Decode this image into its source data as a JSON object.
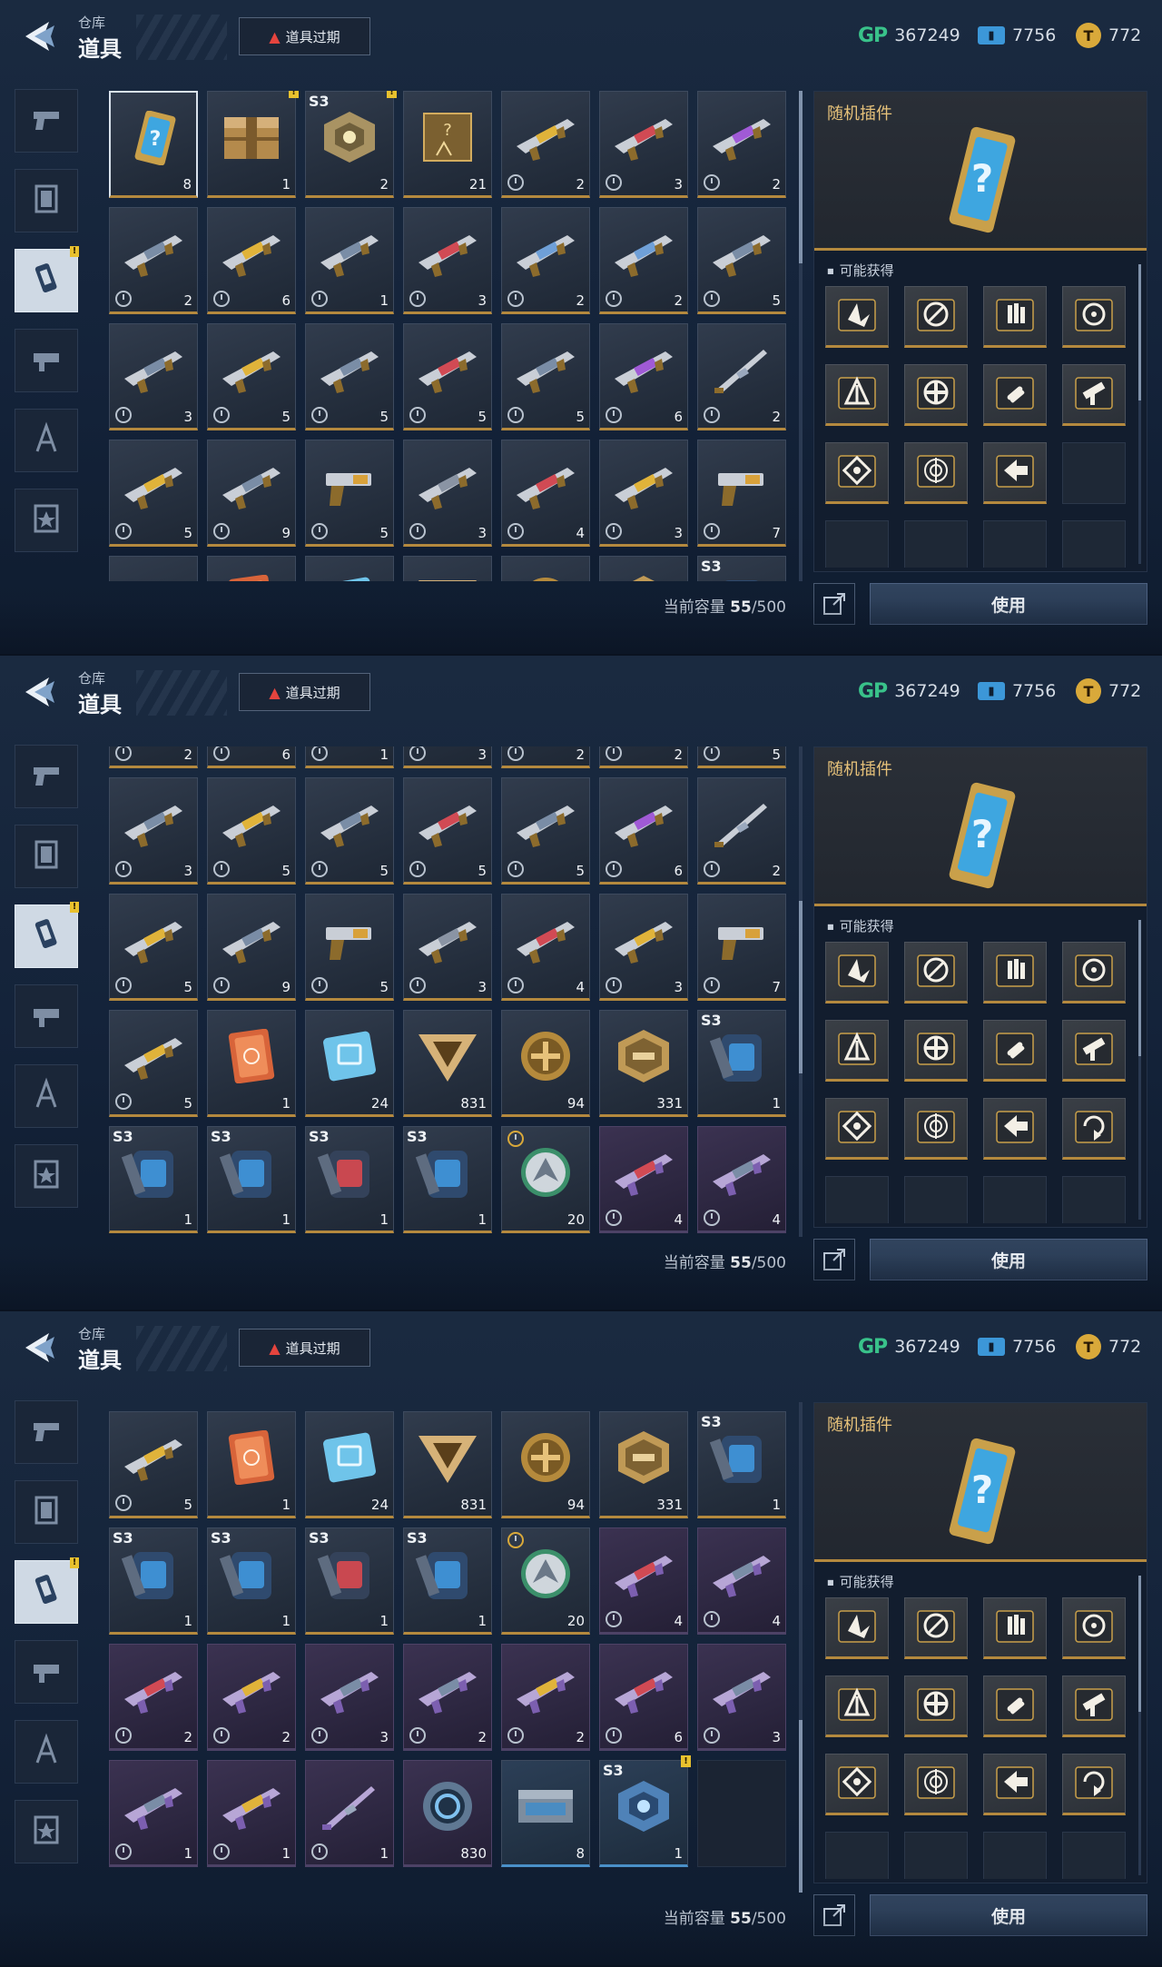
{
  "header": {
    "subtitle": "仓库",
    "title": "道具",
    "expire_button": "道具过期",
    "gp_label": "GP",
    "gp": "367249",
    "tickets": "7756",
    "coins": "772"
  },
  "sidebar": {
    "items": [
      "pistol-icon",
      "frame-icon",
      "plugin-chip-icon",
      "gun-mod-icon",
      "compass-icon",
      "star-badge-icon"
    ],
    "active_index": 2
  },
  "capacity": {
    "label": "当前容量",
    "used": "55",
    "total": "/500"
  },
  "detail": {
    "name": "随机插件",
    "obtain_label": "可能获得",
    "use_button": "使用"
  },
  "colors": {
    "gold": "#b4893e",
    "purple": "#9b6bd4",
    "blue": "#4a90c8",
    "accent_text": "#e7c27a"
  },
  "inventory": [
    {
      "icon": "random-plugin",
      "count": "8",
      "rarity": "gold",
      "selected": true
    },
    {
      "icon": "supply-crate",
      "count": "1",
      "rarity": "gold",
      "alert": true
    },
    {
      "icon": "season-pod",
      "count": "2",
      "rarity": "gold",
      "season": "S3",
      "alert": true
    },
    {
      "icon": "mystery-blueprint",
      "count": "21",
      "rarity": "gold"
    },
    {
      "icon": "smg",
      "count": "2",
      "rarity": "gold",
      "timed": true
    },
    {
      "icon": "launcher",
      "count": "3",
      "rarity": "gold",
      "timed": true
    },
    {
      "icon": "shotgun",
      "count": "2",
      "rarity": "gold",
      "timed": true
    },
    {
      "icon": "rifle",
      "count": "2",
      "rarity": "gold",
      "timed": true
    },
    {
      "icon": "smg",
      "count": "6",
      "rarity": "gold",
      "timed": true
    },
    {
      "icon": "rifle",
      "count": "1",
      "rarity": "gold",
      "timed": true
    },
    {
      "icon": "launcher",
      "count": "3",
      "rarity": "gold",
      "timed": true
    },
    {
      "icon": "crossbow",
      "count": "2",
      "rarity": "gold",
      "timed": true
    },
    {
      "icon": "crossbow",
      "count": "2",
      "rarity": "gold",
      "timed": true
    },
    {
      "icon": "rifle",
      "count": "5",
      "rarity": "gold",
      "timed": true
    },
    {
      "icon": "rifle",
      "count": "3",
      "rarity": "gold",
      "timed": true
    },
    {
      "icon": "smg",
      "count": "5",
      "rarity": "gold",
      "timed": true
    },
    {
      "icon": "rifle",
      "count": "5",
      "rarity": "gold",
      "timed": true
    },
    {
      "icon": "launcher",
      "count": "5",
      "rarity": "gold",
      "timed": true
    },
    {
      "icon": "rifle",
      "count": "5",
      "rarity": "gold",
      "timed": true
    },
    {
      "icon": "shotgun",
      "count": "6",
      "rarity": "gold",
      "timed": true
    },
    {
      "icon": "blade",
      "count": "2",
      "rarity": "gold",
      "timed": true
    },
    {
      "icon": "smg",
      "count": "5",
      "rarity": "gold",
      "timed": true
    },
    {
      "icon": "rifle",
      "count": "9",
      "rarity": "gold",
      "timed": true
    },
    {
      "icon": "pistol",
      "count": "5",
      "rarity": "gold",
      "timed": true
    },
    {
      "icon": "sniper",
      "count": "3",
      "rarity": "gold",
      "timed": true
    },
    {
      "icon": "launcher",
      "count": "4",
      "rarity": "gold",
      "timed": true
    },
    {
      "icon": "smg",
      "count": "3",
      "rarity": "gold",
      "timed": true
    },
    {
      "icon": "pistol",
      "count": "7",
      "rarity": "gold",
      "timed": true
    },
    {
      "icon": "smg",
      "count": "5",
      "rarity": "gold",
      "timed": true
    },
    {
      "icon": "orange-card",
      "count": "1",
      "rarity": "gold"
    },
    {
      "icon": "blue-chip",
      "count": "24",
      "rarity": "gold"
    },
    {
      "icon": "triangle-token",
      "count": "831",
      "rarity": "gold"
    },
    {
      "icon": "gold-coin-token",
      "count": "94",
      "rarity": "gold"
    },
    {
      "icon": "hex-badge",
      "count": "331",
      "rarity": "gold"
    },
    {
      "icon": "backpack",
      "count": "1",
      "rarity": "gold",
      "season": "S3"
    },
    {
      "icon": "backpack",
      "count": "1",
      "rarity": "gold",
      "season": "S3"
    },
    {
      "icon": "backpack",
      "count": "1",
      "rarity": "gold",
      "season": "S3"
    },
    {
      "icon": "backpack-red",
      "count": "1",
      "rarity": "gold",
      "season": "S3"
    },
    {
      "icon": "backpack",
      "count": "1",
      "rarity": "gold",
      "season": "S3"
    },
    {
      "icon": "emblem",
      "count": "20",
      "rarity": "gold",
      "timed_top": true
    },
    {
      "icon": "launcher",
      "count": "4",
      "rarity": "purple",
      "timed": true
    },
    {
      "icon": "rifle",
      "count": "4",
      "rarity": "purple",
      "timed": true
    },
    {
      "icon": "launcher",
      "count": "2",
      "rarity": "purple",
      "timed": true
    },
    {
      "icon": "smg",
      "count": "2",
      "rarity": "purple",
      "timed": true
    },
    {
      "icon": "rifle",
      "count": "3",
      "rarity": "purple",
      "timed": true
    },
    {
      "icon": "rifle",
      "count": "2",
      "rarity": "purple",
      "timed": true
    },
    {
      "icon": "smg",
      "count": "2",
      "rarity": "purple",
      "timed": true
    },
    {
      "icon": "launcher",
      "count": "6",
      "rarity": "purple",
      "timed": true
    },
    {
      "icon": "rifle",
      "count": "3",
      "rarity": "purple",
      "timed": true
    },
    {
      "icon": "rifle",
      "count": "1",
      "rarity": "purple",
      "timed": true
    },
    {
      "icon": "smg",
      "count": "1",
      "rarity": "purple",
      "timed": true
    },
    {
      "icon": "blade",
      "count": "1",
      "rarity": "purple",
      "timed": true
    },
    {
      "icon": "ring-token",
      "count": "830",
      "rarity": "purple"
    },
    {
      "icon": "ammo-box",
      "count": "8",
      "rarity": "blue"
    },
    {
      "icon": "season-pod-blue",
      "count": "1",
      "rarity": "blue",
      "season": "S3",
      "alert": true
    },
    {
      "icon": "empty",
      "count": "",
      "rarity": "empty"
    }
  ],
  "plugins_a": [
    "wing-plugin",
    "shield-plugin",
    "hand-plugin",
    "sight-plugin",
    "fork-plugin",
    "gear-plugin",
    "bullet-plugin",
    "gun-plugin",
    "chip-plugin",
    "target-plugin",
    "arrow-plugin",
    "empty"
  ],
  "plugins_b": [
    "wing-plugin",
    "shield-plugin",
    "hand-plugin",
    "sight-plugin",
    "fork-plugin",
    "gear-plugin",
    "bullet-plugin",
    "gun-plugin",
    "chip-plugin",
    "target-plugin",
    "arrow-plugin",
    "rotate-plugin"
  ]
}
